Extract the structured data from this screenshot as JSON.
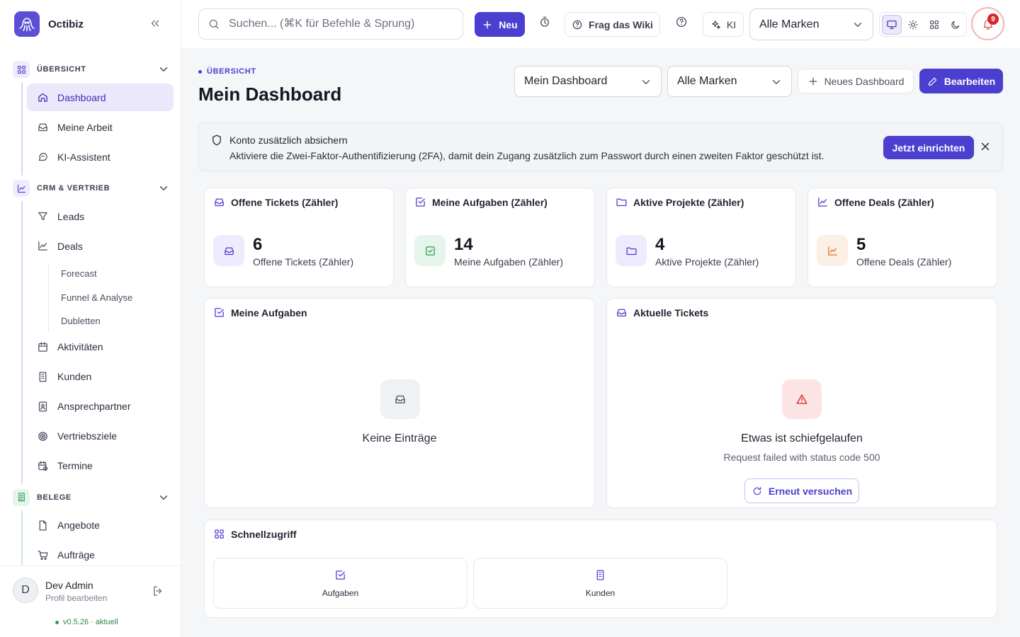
{
  "app": {
    "name": "Octibiz"
  },
  "sidebar": {
    "sections": [
      {
        "label": "ÜBERSICHT",
        "items": [
          "Dashboard",
          "Meine Arbeit",
          "KI-Assistent"
        ]
      },
      {
        "label": "CRM & VERTRIEB",
        "items": [
          "Leads",
          "Deals"
        ],
        "deal_subitems": [
          "Forecast",
          "Funnel & Analyse",
          "Dubletten"
        ],
        "items_after": [
          "Aktivitäten",
          "Kunden",
          "Ansprechpartner",
          "Vertriebsziele",
          "Termine"
        ]
      },
      {
        "label": "BELEGE",
        "items": [
          "Angebote",
          "Aufträge"
        ]
      }
    ],
    "active_item": "Dashboard",
    "profile": {
      "initial": "D",
      "name": "Dev Admin",
      "subtitle": "Profil bearbeiten"
    },
    "version": "v0.5.26 · aktuell"
  },
  "topbar": {
    "search_placeholder": "Suchen... (⌘K für Befehle & Sprung)",
    "new_label": "Neu",
    "wiki_label": "Frag das Wiki",
    "ki_label": "KI",
    "brand_select": "Alle Marken",
    "notifications_count": "9"
  },
  "main": {
    "breadcrumb": "ÜBERSICHT",
    "title": "Mein Dashboard",
    "dashboard_select": "Mein Dashboard",
    "brand_select": "Alle Marken",
    "new_dashboard_label": "Neues Dashboard",
    "edit_label": "Bearbeiten",
    "banner": {
      "title": "Konto zusätzlich absichern",
      "text": "Aktiviere die Zwei-Faktor-Authentifizierung (2FA), damit dein Zugang zusätzlich zum Passwort durch einen zweiten Faktor geschützt ist.",
      "button": "Jetzt einrichten"
    },
    "kpis": [
      {
        "title": "Offene Tickets (Zähler)",
        "value": "6",
        "label": "Offene Tickets (Zähler)",
        "color": "#4b3fd0",
        "bg": "#eeebfc",
        "icon": "inbox-icon"
      },
      {
        "title": "Meine Aufgaben (Zähler)",
        "value": "14",
        "label": "Meine Aufgaben (Zähler)",
        "color": "#2f9a50",
        "bg": "#e6f5eb",
        "icon": "check-square-icon"
      },
      {
        "title": "Aktive Projekte (Zähler)",
        "value": "4",
        "label": "Aktive Projekte (Zähler)",
        "color": "#4b3fd0",
        "bg": "#eeebfc",
        "icon": "folder-icon"
      },
      {
        "title": "Offene Deals (Zähler)",
        "value": "5",
        "label": "Offene Deals (Zähler)",
        "color": "#d97a2b",
        "bg": "#fcefe4",
        "icon": "trend-icon"
      }
    ],
    "tasks_widget": {
      "title": "Meine Aufgaben",
      "empty": "Keine Einträge"
    },
    "tickets_widget": {
      "title": "Aktuelle Tickets",
      "error_title": "Etwas ist schiefgelaufen",
      "error_text": "Request failed with status code 500",
      "retry": "Erneut versuchen"
    },
    "quick_access": {
      "title": "Schnellzugriff",
      "items": [
        "Aufgaben",
        "Kunden"
      ]
    }
  },
  "colors": {
    "accent": "#4b3fd0",
    "error": "#d62828"
  }
}
